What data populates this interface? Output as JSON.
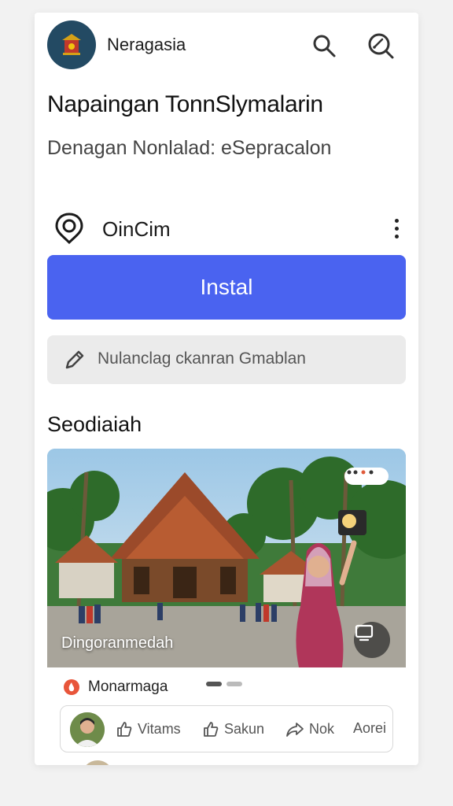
{
  "header": {
    "app_name": "Neragasia",
    "search_icon": "search-icon",
    "lens_icon": "lens-search-icon"
  },
  "article": {
    "headline": "Napaingan TonnSlymalarin",
    "subline": "Denagan Nonlalad: eSepracalon"
  },
  "source": {
    "name": "OinCim",
    "icon": "location-pin-icon",
    "more_icon": "more-vertical-icon"
  },
  "install_label": "Instal",
  "edit_field": {
    "icon": "pencil-icon",
    "value": "Nulanclag ckanran Gmablan"
  },
  "section": {
    "title": "Seodiaiah"
  },
  "hero": {
    "caption": "Dingoranmedah",
    "badge_icon": "dots-icon",
    "action_icon": "screen-cast-icon"
  },
  "meta": {
    "label": "Monarmaga",
    "icon": "flame-icon"
  },
  "actions": {
    "like_label": "Vitams",
    "save_label": "Sakun",
    "share_label": "Nok",
    "more_label": "Aorei"
  },
  "colors": {
    "accent": "#4a63f0",
    "logo_bg": "#234a63",
    "field_bg": "#ebebeb"
  }
}
